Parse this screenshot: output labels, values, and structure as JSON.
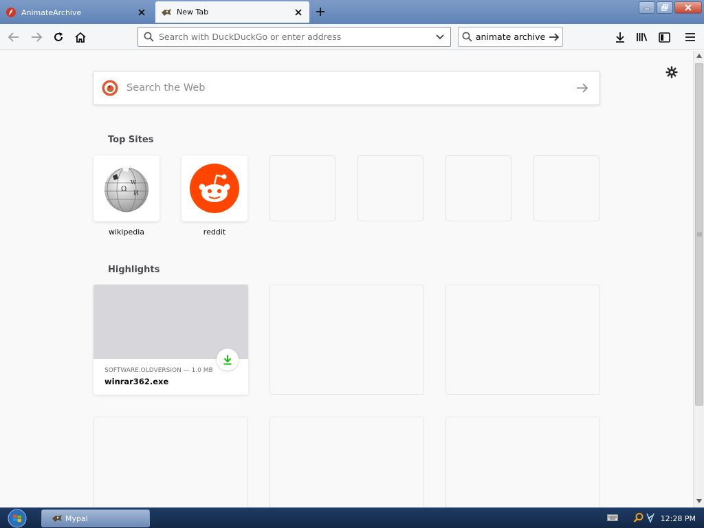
{
  "tabs": [
    {
      "title": "AnimateArchive",
      "active": false
    },
    {
      "title": "New Tab",
      "active": true
    }
  ],
  "toolbar": {
    "url_placeholder": "Search with DuckDuckGo or enter address",
    "search_value": "animate archive"
  },
  "newtab": {
    "search_placeholder": "Search the Web",
    "top_sites_title": "Top Sites",
    "top_sites": [
      {
        "label": "wikipedia"
      },
      {
        "label": "reddit"
      }
    ],
    "highlights_title": "Highlights",
    "highlight": {
      "meta": "SOFTWARE.OLDVERSION — 1.0 MB",
      "name": "winrar362.exe"
    }
  },
  "taskbar": {
    "app_label": "Mypal",
    "clock": "12:28 PM"
  },
  "colors": {
    "reddit_orange": "#ff4500",
    "download_green": "#12bc00",
    "accent": "#0a84ff"
  }
}
